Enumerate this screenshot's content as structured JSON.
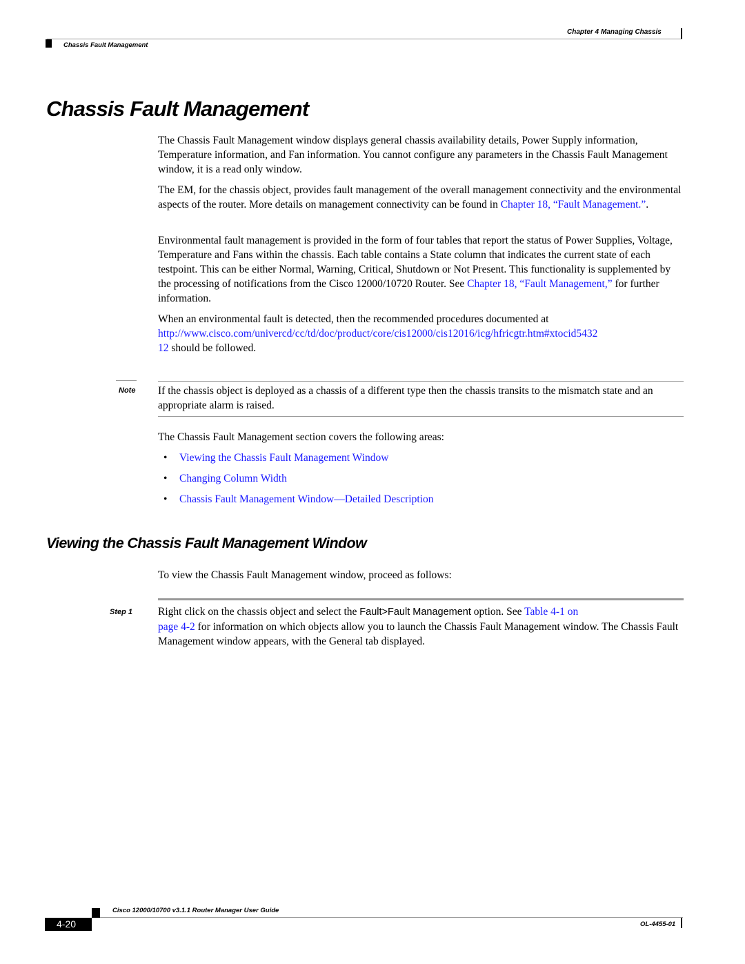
{
  "header": {
    "chapter_label": "Chapter 4",
    "chapter_title": "Managing Chassis",
    "section_label": "Chassis Fault Management"
  },
  "title": "Chassis Fault Management",
  "paragraphs": {
    "p1": "The Chassis Fault Management window displays general chassis availability details, Power Supply information, Temperature information, and Fan information. You cannot configure any parameters in the Chassis Fault Management window, it is a read only window.",
    "p2_text": "The EM, for the chassis object, provides fault management of the overall management connectivity and the environmental aspects of the router. More details on management connectivity can be found in ",
    "p2_link": "Chapter 18, “Fault Management.”",
    "p2_end": ".",
    "p3_text": "Environmental fault management is provided in the form of four tables that report the status of Power Supplies, Voltage, Temperature and Fans within the chassis. Each table contains a State column that indicates the current state of each testpoint. This can be either Normal, Warning, Critical, Shutdown or Not Present. This functionality is supplemented by the processing of notifications from the Cisco 12000/10720 Router. See ",
    "p3_link": "Chapter 18, “Fault Management,”",
    "p3_end": " for further information.",
    "p4_text": "When an environmental fault is detected, then the recommended procedures documented at ",
    "p4_link_line1": "http://www.cisco.com/univercd/cc/td/doc/product/core/cis12000/cis12016/icg/hfricgtr.htm#xtocid5432",
    "p4_link_line2": "12",
    "p4_end": " should be followed."
  },
  "note": {
    "label": "Note",
    "text": "If the chassis object is deployed as a chassis of a different type then the chassis transits to the mismatch state and an appropriate alarm is raised."
  },
  "section_intro": "The Chassis Fault Management section covers the following areas:",
  "bullets": [
    {
      "symbol": "•",
      "label": "Viewing the Chassis Fault Management Window"
    },
    {
      "symbol": "•",
      "label": "Changing Column Width"
    },
    {
      "symbol": "•",
      "label": "Chassis Fault Management Window—Detailed Description"
    }
  ],
  "subsection": {
    "title": "Viewing the Chassis Fault Management Window",
    "intro": "To view the Chassis Fault Management window, proceed as follows:"
  },
  "step1": {
    "label": "Step 1",
    "text_a": "Right click on the chassis object and select the ",
    "menu_path": "Fault>Fault Management",
    "text_b": " option. See ",
    "link_a": "Table 4-1 on",
    "link_b": "page 4-2",
    "text_c": " for information on which objects allow you to launch the Chassis Fault Management window. The Chassis Fault Management window appears, with the General tab displayed."
  },
  "footer": {
    "guide_title": "Cisco 12000/10700 v3.1.1 Router Manager User Guide",
    "page_number": "4-20",
    "doc_number": "OL-4455-01"
  },
  "colors": {
    "link": "#1a1aff",
    "rule": "#9a9a9a",
    "text": "#000000"
  }
}
